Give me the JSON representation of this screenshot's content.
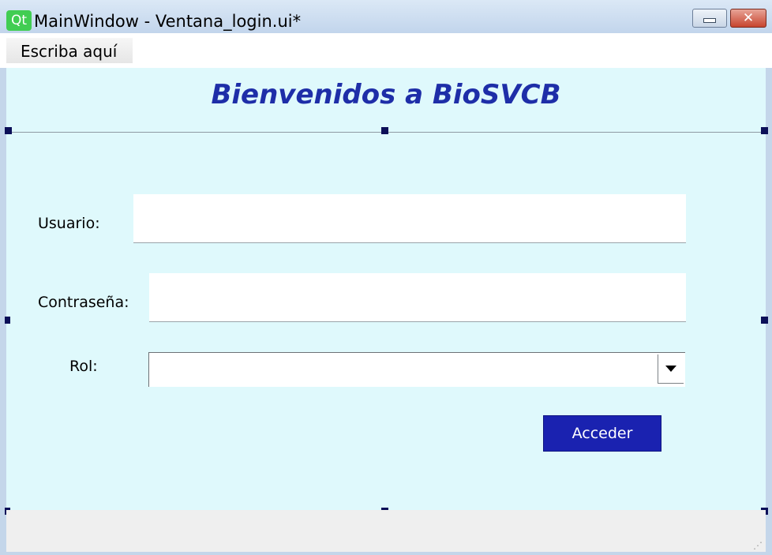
{
  "window": {
    "logo_text": "Qt",
    "title": "MainWindow - Ventana_login.ui*",
    "minimize_glyph": "minimize-icon",
    "close_glyph": "✕"
  },
  "menubar": {
    "items": [
      {
        "label": "Escriba aquí"
      }
    ]
  },
  "form": {
    "heading": "Bienvenidos a BioSVCB",
    "usuario_label": "Usuario:",
    "usuario_value": "",
    "password_label": "Contraseña:",
    "password_value": "",
    "rol_label": "Rol:",
    "rol_selected": "",
    "submit_label": "Acceder"
  },
  "colors": {
    "form_background": "#dff9fc",
    "heading": "#1e2ea8",
    "submit_button": "#1a22b0",
    "selection_handle": "#0b0f58"
  },
  "icons": {
    "dropdown": "chevron-down-icon",
    "resize_grip": "resize-grip-icon",
    "close": "close-icon",
    "minimize": "minimize-icon",
    "logo": "qt-logo-icon"
  }
}
